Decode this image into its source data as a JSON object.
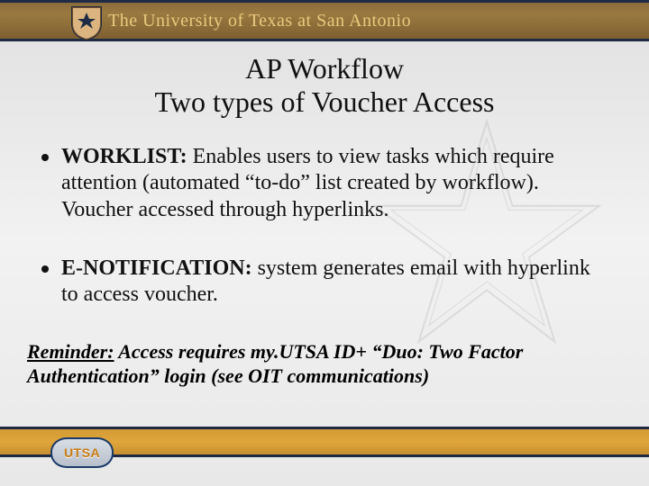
{
  "header": {
    "org_name": "The University of Texas at San Antonio"
  },
  "title": {
    "line1": "AP Workflow",
    "line2": "Two types of Voucher Access"
  },
  "bullets": [
    {
      "lead": "WORKLIST:",
      "body": "  Enables users to view tasks which require attention (automated “to-do” list created by workflow). Voucher accessed through hyperlinks."
    },
    {
      "lead": "E-NOTIFICATION:",
      "body": " system generates email with hyperlink to access voucher."
    }
  ],
  "reminder": {
    "label": "Reminder:",
    "body": " Access requires my.UTSA ID+ “Duo: Two Factor Authentication” login (see OIT communications)"
  },
  "footer": {
    "logo_text": "UTSA"
  }
}
